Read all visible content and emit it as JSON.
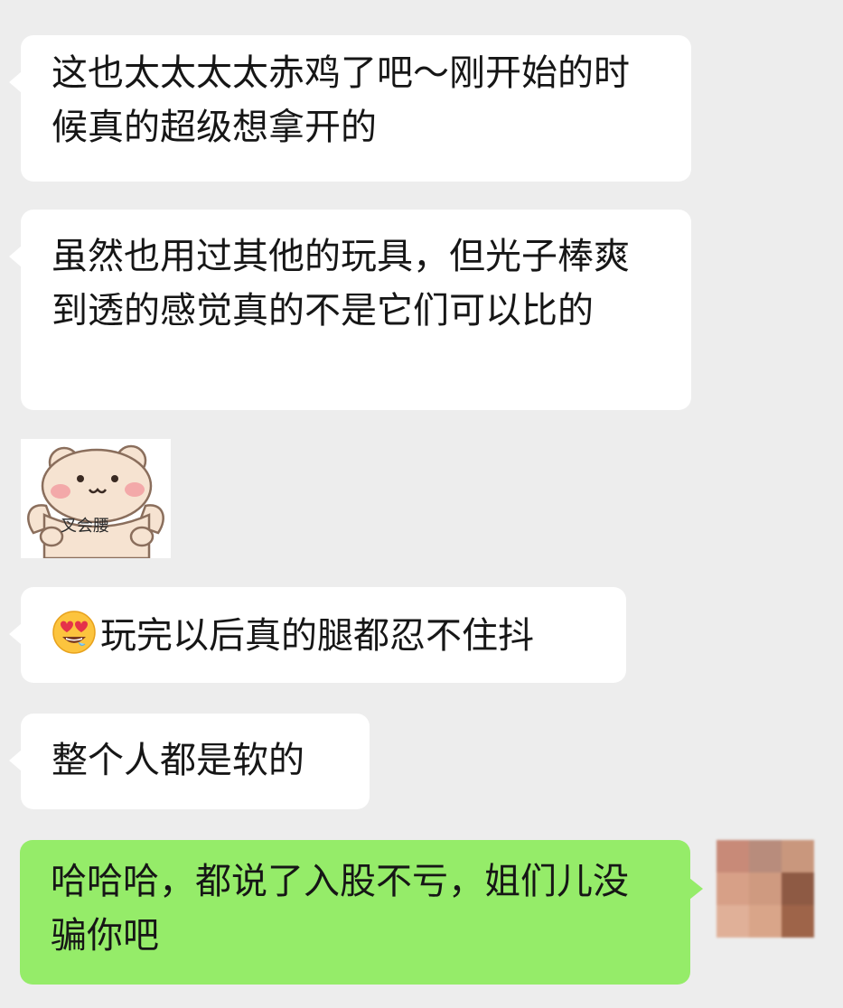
{
  "chat": {
    "messages": [
      {
        "side": "incoming",
        "text": "这也太太太太赤鸡了吧～刚开始的时候真的超级想拿开的"
      },
      {
        "side": "incoming",
        "text": "虽然也用过其他的玩具，但光子棒爽到透的感觉真的不是它们可以比的"
      },
      {
        "side": "incoming",
        "type": "sticker",
        "caption": "叉会腰"
      },
      {
        "side": "incoming",
        "emoji": "heart-eyes-emoji",
        "text": "玩完以后真的腿都忍不住抖"
      },
      {
        "side": "incoming",
        "text": "整个人都是软的"
      },
      {
        "side": "outgoing",
        "text": "哈哈哈，都说了入股不亏，姐们儿没骗你吧"
      }
    ]
  },
  "avatar": {
    "icon": "pixelated-avatar",
    "colors": [
      "#c88a78",
      "#b88c7c",
      "#c9977d",
      "#d7a087",
      "#cf9a80",
      "#8e5a44",
      "#e0b098",
      "#d9a589",
      "#9e6449"
    ]
  },
  "colors": {
    "background": "#ededed",
    "incoming_bubble": "#ffffff",
    "outgoing_bubble": "#95ec69",
    "text": "#161616"
  }
}
